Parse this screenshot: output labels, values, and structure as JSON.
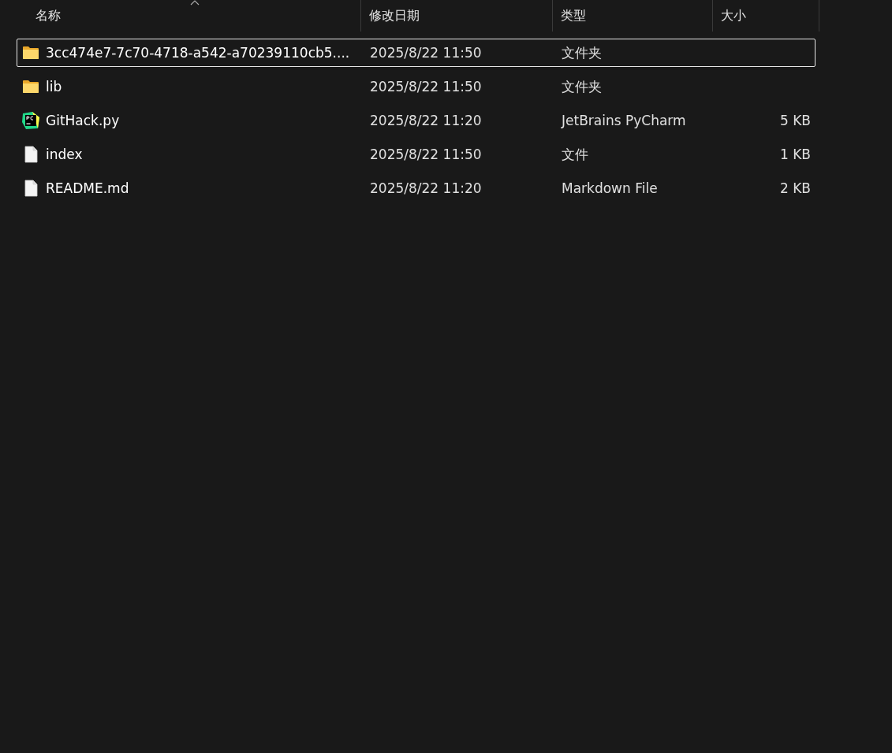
{
  "columns": [
    {
      "label": "名称",
      "sorted": true
    },
    {
      "label": "修改日期",
      "sorted": false
    },
    {
      "label": "类型",
      "sorted": false
    },
    {
      "label": "大小",
      "sorted": false
    }
  ],
  "rows": [
    {
      "kind": "folder",
      "name": "3cc474e7-7c70-4718-a542-a70239110cb5....",
      "modified": "2025/8/22 11:50",
      "type": "文件夹",
      "focused": true
    },
    {
      "kind": "folder",
      "name": "lib",
      "modified": "2025/8/22 11:50",
      "type": "文件夹",
      "focused": false
    },
    {
      "kind": "pycharm",
      "name": "GitHack.py",
      "modified": "2025/8/22 11:20",
      "type": "JetBrains PyCharm",
      "size": "5 KB",
      "focused": false
    },
    {
      "kind": "file",
      "name": "index",
      "modified": "2025/8/22 11:50",
      "type": "文件",
      "size": "1 KB",
      "focused": false
    },
    {
      "kind": "file",
      "name": "README.md",
      "modified": "2025/8/22 11:20",
      "type": "Markdown File",
      "size": "2 KB",
      "focused": false
    }
  ]
}
